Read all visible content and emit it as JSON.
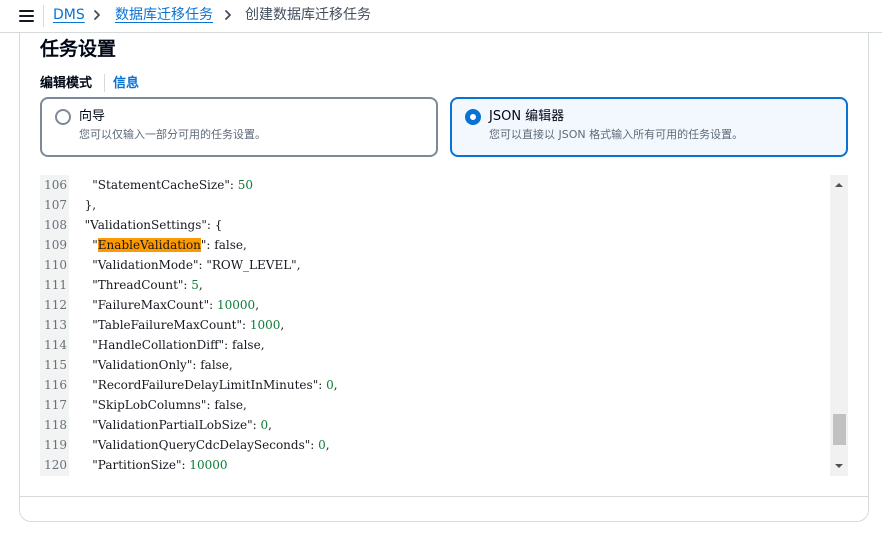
{
  "breadcrumb": {
    "items": [
      "DMS",
      "数据库迁移任务",
      "创建数据库迁移任务"
    ]
  },
  "section": {
    "title": "任务设置",
    "mode_label": "编辑模式",
    "info_link": "信息"
  },
  "tiles": [
    {
      "title": "向导",
      "description": "您可以仅输入一部分可用的任务设置。",
      "selected": false
    },
    {
      "title": "JSON 编辑器",
      "description": "您可以直接以 JSON 格式输入所有可用的任务设置。",
      "selected": true
    }
  ],
  "editor": {
    "lines": [
      {
        "n": "106",
        "indent": "    ",
        "key": "StatementCacheSize",
        "value": "50",
        "vtype": "num",
        "suffix": ""
      },
      {
        "n": "107",
        "indent": "  ",
        "raw": "},"
      },
      {
        "n": "108",
        "indent": "  ",
        "key": "ValidationSettings",
        "value": "{",
        "vtype": "punct",
        "suffix": ""
      },
      {
        "n": "109",
        "indent": "    ",
        "key": "EnableValidation",
        "value": "false",
        "vtype": "bool",
        "suffix": ",",
        "highlight": true
      },
      {
        "n": "110",
        "indent": "    ",
        "key": "ValidationMode",
        "value": "\"ROW_LEVEL\"",
        "vtype": "str",
        "suffix": ","
      },
      {
        "n": "111",
        "indent": "    ",
        "key": "ThreadCount",
        "value": "5",
        "vtype": "num",
        "suffix": ","
      },
      {
        "n": "112",
        "indent": "    ",
        "key": "FailureMaxCount",
        "value": "10000",
        "vtype": "num",
        "suffix": ","
      },
      {
        "n": "113",
        "indent": "    ",
        "key": "TableFailureMaxCount",
        "value": "1000",
        "vtype": "num",
        "suffix": ","
      },
      {
        "n": "114",
        "indent": "    ",
        "key": "HandleCollationDiff",
        "value": "false",
        "vtype": "bool",
        "suffix": ","
      },
      {
        "n": "115",
        "indent": "    ",
        "key": "ValidationOnly",
        "value": "false",
        "vtype": "bool",
        "suffix": ","
      },
      {
        "n": "116",
        "indent": "    ",
        "key": "RecordFailureDelayLimitInMinutes",
        "value": "0",
        "vtype": "num",
        "suffix": ","
      },
      {
        "n": "117",
        "indent": "    ",
        "key": "SkipLobColumns",
        "value": "false",
        "vtype": "bool",
        "suffix": ","
      },
      {
        "n": "118",
        "indent": "    ",
        "key": "ValidationPartialLobSize",
        "value": "0",
        "vtype": "num",
        "suffix": ","
      },
      {
        "n": "119",
        "indent": "    ",
        "key": "ValidationQueryCdcDelaySeconds",
        "value": "0",
        "vtype": "num",
        "suffix": ","
      },
      {
        "n": "120",
        "indent": "    ",
        "key": "PartitionSize",
        "value": "10000",
        "vtype": "num",
        "suffix": ""
      }
    ]
  },
  "colors": {
    "accent": "#0972d3",
    "highlight": "#ff9900",
    "number": "#0e7c3a"
  }
}
